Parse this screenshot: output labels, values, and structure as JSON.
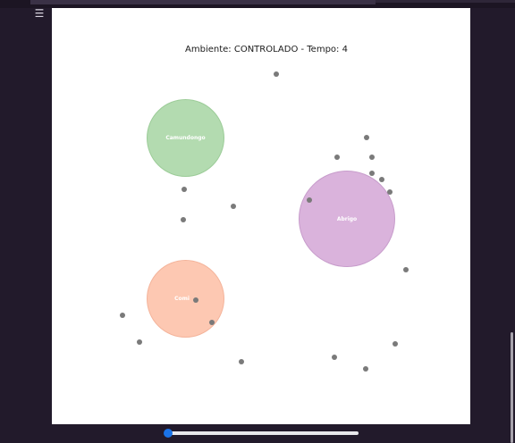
{
  "toolbar": {
    "menu_icon": "sliders-icon"
  },
  "plot": {
    "title": "Ambiente: CONTROLADO - Tempo: 4",
    "zones": [
      {
        "label": "Camundongo",
        "color": "#b3dbb0",
        "border": "#9ccc98"
      },
      {
        "label": "Abrigo",
        "color": "#dab3dc",
        "border": "#c79ccb"
      },
      {
        "label": "Comi",
        "color": "#fdc8b2",
        "border": "#f4b49b"
      }
    ]
  },
  "slider": {
    "value": 0,
    "accent": "#1a73e8"
  }
}
